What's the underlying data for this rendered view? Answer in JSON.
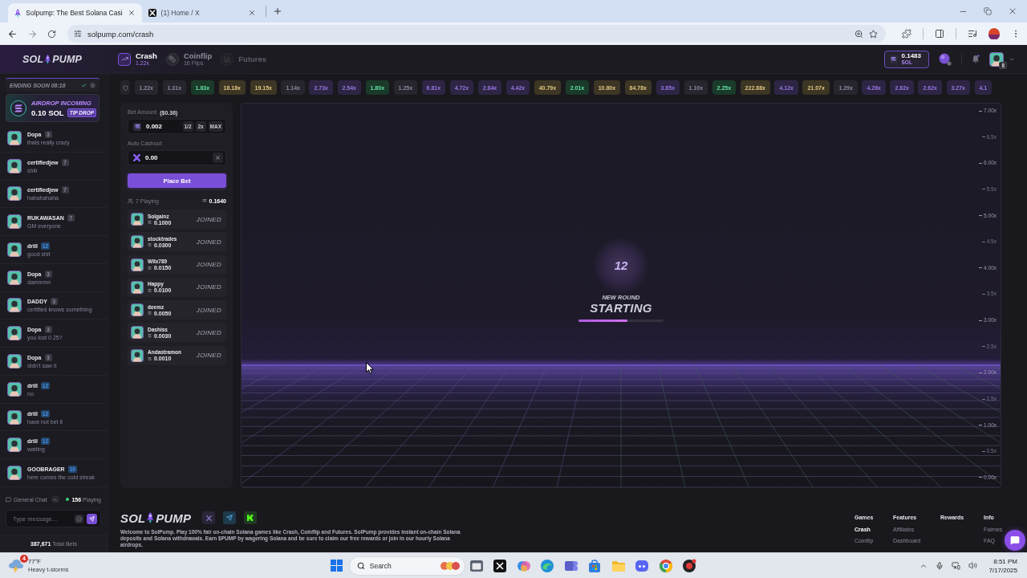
{
  "browser": {
    "tabs": [
      {
        "title": "Solpump: The Best Solana Casi",
        "selected": true
      },
      {
        "title": "(1) Home / X",
        "selected": false
      }
    ],
    "url": "solpump.com/crash"
  },
  "header": {
    "logo": {
      "left": "SOL",
      "right": "PUMP"
    },
    "nav": [
      {
        "label": "Crash",
        "sub": "1.22x",
        "selected": true,
        "disabled": false
      },
      {
        "label": "Coinflip",
        "sub": "16 Flips",
        "selected": false,
        "disabled": false
      },
      {
        "label": "Futures",
        "selected": false,
        "disabled": true
      }
    ],
    "balance": {
      "amount": "0.1483",
      "unit": "SOL"
    },
    "avatar_badge": "8"
  },
  "sidebar": {
    "banner": "ENDING SOON 08:18",
    "airdrop": {
      "title": "AIRDROP INCOMING",
      "amount": "0.10 SOL",
      "badge": "TIP DROP"
    },
    "messages": [
      {
        "name": "Dopa",
        "badge": {
          "text": "3",
          "color": "#3a3942"
        },
        "text": "thats really crazy"
      },
      {
        "name": "certifiedjew",
        "badge": {
          "text": "7",
          "color": "#3a3942"
        },
        "text": "shiii"
      },
      {
        "name": "certifiedjew",
        "badge": {
          "text": "7",
          "color": "#3a3942"
        },
        "text": "hahahahaha"
      },
      {
        "name": "RUKAWASAN",
        "badge": {
          "text": "7",
          "color": "#3a3942"
        },
        "text": "GM everyone"
      },
      {
        "name": "drill",
        "badge": {
          "text": "12",
          "color": "#24476e"
        },
        "text": "good shit"
      },
      {
        "name": "Dopa",
        "badge": {
          "text": "3",
          "color": "#3a3942"
        },
        "text": "dammmn"
      },
      {
        "name": "DADDY",
        "badge": {
          "text": "3",
          "color": "#3a3942"
        },
        "text": "certified knows something"
      },
      {
        "name": "Dopa",
        "badge": {
          "text": "3",
          "color": "#3a3942"
        },
        "text": "you lost 0.25?"
      },
      {
        "name": "Dopa",
        "badge": {
          "text": "3",
          "color": "#3a3942"
        },
        "text": "didn't saw it"
      },
      {
        "name": "drill",
        "badge": {
          "text": "12",
          "color": "#24476e"
        },
        "text": "no"
      },
      {
        "name": "drill",
        "badge": {
          "text": "12",
          "color": "#24476e"
        },
        "text": "have not bet it"
      },
      {
        "name": "drill",
        "badge": {
          "text": "12",
          "color": "#24476e"
        },
        "text": "waiting"
      },
      {
        "name": "GOOBRAGER",
        "badge": {
          "text": "10",
          "color": "#24476e"
        },
        "text": "here comes the cold streak"
      }
    ],
    "chat": {
      "room": "General Chat",
      "online": "156",
      "online_label": "Playing",
      "placeholder": "Type message..."
    },
    "total_bets": {
      "value": "387,671",
      "label": "Total Bets"
    }
  },
  "multipliers": [
    {
      "value": "1.22x",
      "color": "#27262d"
    },
    {
      "value": "1.31x",
      "color": "#27262d"
    },
    {
      "value": "1.83x",
      "color": "#1a3a2a"
    },
    {
      "value": "18.18x",
      "color": "#3d3624"
    },
    {
      "value": "19.15x",
      "color": "#3d3624"
    },
    {
      "value": "1.14x",
      "color": "#27262d"
    },
    {
      "value": "2.73x",
      "color": "#2e2545"
    },
    {
      "value": "2.54x",
      "color": "#2e2545"
    },
    {
      "value": "1.80x",
      "color": "#1a3a2a"
    },
    {
      "value": "1.25x",
      "color": "#27262d"
    },
    {
      "value": "6.81x",
      "color": "#2e2545"
    },
    {
      "value": "4.72x",
      "color": "#2e2545"
    },
    {
      "value": "2.84x",
      "color": "#2e2545"
    },
    {
      "value": "4.42x",
      "color": "#2e2545"
    },
    {
      "value": "40.79x",
      "color": "#3d3624"
    },
    {
      "value": "2.01x",
      "color": "#1a3a2a"
    },
    {
      "value": "10.80x",
      "color": "#3d3624"
    },
    {
      "value": "84.78x",
      "color": "#3d3624"
    },
    {
      "value": "3.85x",
      "color": "#2e2545"
    },
    {
      "value": "1.10x",
      "color": "#27262d"
    },
    {
      "value": "2.25x",
      "color": "#1a3a2a"
    },
    {
      "value": "222.88x",
      "color": "#3d3624"
    },
    {
      "value": "4.12x",
      "color": "#2e2545"
    },
    {
      "value": "21.07x",
      "color": "#3d3624"
    },
    {
      "value": "1.29x",
      "color": "#27262d"
    },
    {
      "value": "4.28x",
      "color": "#2e2545"
    },
    {
      "value": "2.82x",
      "color": "#2e2545"
    },
    {
      "value": "2.62x",
      "color": "#2e2545"
    },
    {
      "value": "3.27x",
      "color": "#2e2545"
    },
    {
      "value": "4.1",
      "color": "#2e2545"
    }
  ],
  "bet_panel": {
    "amount_label": "Bet Amount",
    "amount_usd": "($0.36)",
    "amount": "0.002",
    "quick": [
      "1/2",
      "2x",
      "MAX"
    ],
    "cashout_label": "Auto Cashout",
    "cashout": "0.00",
    "place": "Place Bet",
    "players_count": "7 Playing",
    "pot": "0.1640",
    "players": [
      {
        "name": "Solgainz",
        "bet": "0.1000",
        "status": "JOINED"
      },
      {
        "name": "stocktrades",
        "bet": "0.0300",
        "status": "JOINED"
      },
      {
        "name": "Wllx789",
        "bet": "0.0150",
        "status": "JOINED"
      },
      {
        "name": "Happy",
        "bet": "0.0100",
        "status": "JOINED"
      },
      {
        "name": "deemz",
        "bet": "0.0050",
        "status": "JOINED"
      },
      {
        "name": "Dashiss",
        "bet": "0.0030",
        "status": "JOINED"
      },
      {
        "name": "Andastramon",
        "bet": "0.0010",
        "status": "JOINED"
      }
    ]
  },
  "game": {
    "countdown": "12",
    "caption": "NEW ROUND",
    "status": "STARTING",
    "progress": {
      "level": 0.58
    },
    "axis": [
      {
        "label": "7.00x",
        "kind": "major"
      },
      {
        "label": "6.5x",
        "kind": "minor"
      },
      {
        "label": "6.00x",
        "kind": "major"
      },
      {
        "label": "5.5x",
        "kind": "minor"
      },
      {
        "label": "5.00x",
        "kind": "major"
      },
      {
        "label": "4.5x",
        "kind": "minor"
      },
      {
        "label": "4.00x",
        "kind": "major"
      },
      {
        "label": "3.5x",
        "kind": "minor"
      },
      {
        "label": "3.00x",
        "kind": "major"
      },
      {
        "label": "2.5x",
        "kind": "minor"
      },
      {
        "label": "2.00x",
        "kind": "major"
      },
      {
        "label": "1.5x",
        "kind": "minor"
      },
      {
        "label": "1.00x",
        "kind": "major"
      },
      {
        "label": "0.5x",
        "kind": "minor"
      },
      {
        "label": "0.00x",
        "kind": "major"
      }
    ]
  },
  "footer": {
    "logo": {
      "left": "SOL",
      "right": "PUMP"
    },
    "description": "Welcome to SolPump. Play 100% fair on-chain Solana games like Crash, Coinflip and Futures. SolPump provides instant on-chain Solana deposits and Solana withdrawals. Earn $PUMP by wagering Solana and be sure to claim our free rewards or join in our hourly Solana airdrops.",
    "columns": [
      {
        "title": "Games",
        "links": [
          {
            "label": "Crash",
            "selected": true
          },
          {
            "label": "Coinflip",
            "selected": false
          }
        ]
      },
      {
        "title": "Features",
        "links": [
          {
            "label": "Affiliates",
            "selected": false
          },
          {
            "label": "Dashboard",
            "selected": false
          }
        ]
      },
      {
        "title": "Rewards"
      },
      {
        "title": "Info",
        "links": [
          {
            "label": "Fairnes",
            "selected": false
          },
          {
            "label": "FAQ",
            "selected": false
          }
        ]
      }
    ]
  },
  "taskbar": {
    "weather": {
      "temp": "77°F",
      "condition": "Heavy t-storms",
      "alerts": "4"
    },
    "search": {
      "placeholder": "Search"
    },
    "clock": {
      "time": "8:51 PM",
      "date": "7/17/2025"
    }
  }
}
